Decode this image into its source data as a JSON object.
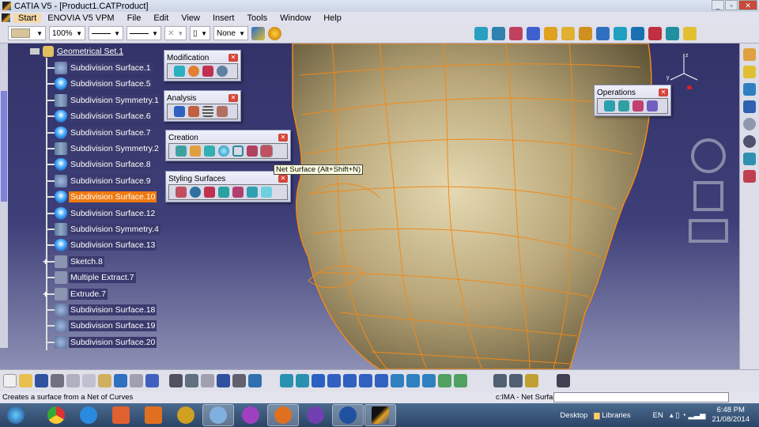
{
  "window": {
    "title": "CATIA V5 - [Product1.CATProduct]",
    "buttons": [
      "minimize",
      "restore",
      "close"
    ]
  },
  "menu": [
    "Start",
    "ENOVIA V5 VPM",
    "File",
    "Edit",
    "View",
    "Insert",
    "Tools",
    "Window",
    "Help"
  ],
  "top_toolbar": {
    "color_swatch": "#d8c49a",
    "zoom": "100%",
    "layer": "None"
  },
  "tree": {
    "root": "Geometrical Set.1",
    "items": [
      {
        "label": "Subdivision Surface.1",
        "icon": "subdivision-surface-icon"
      },
      {
        "label": "Subdivision Surface.5",
        "icon": "subdivision-surface-icon"
      },
      {
        "label": "Subdivision Symmetry.1",
        "icon": "subdivision-symmetry-icon"
      },
      {
        "label": "Subdivision Surface.6",
        "icon": "subdivision-surface-icon"
      },
      {
        "label": "Subdivision Surface.7",
        "icon": "subdivision-surface-icon"
      },
      {
        "label": "Subdivision Symmetry.2",
        "icon": "subdivision-symmetry-icon"
      },
      {
        "label": "Subdivision Surface.8",
        "icon": "subdivision-surface-icon"
      },
      {
        "label": "Subdivision Surface.9",
        "icon": "subdivision-surface-icon"
      },
      {
        "label": "Subdivision Surface.10",
        "icon": "subdivision-surface-icon",
        "selected": true
      },
      {
        "label": "Subdivision Surface.12",
        "icon": "subdivision-surface-icon"
      },
      {
        "label": "Subdivision Symmetry.4",
        "icon": "subdivision-symmetry-icon"
      },
      {
        "label": "Subdivision Surface.13",
        "icon": "subdivision-surface-icon"
      },
      {
        "label": "Sketch.8",
        "icon": "sketch-icon",
        "expandable": true
      },
      {
        "label": "Multiple Extract.7",
        "icon": "extract-icon"
      },
      {
        "label": "Extrude.7",
        "icon": "extrude-icon",
        "expandable": true
      },
      {
        "label": "Subdivision Surface.18",
        "icon": "subdivision-surface-icon"
      },
      {
        "label": "Subdivision Surface.19",
        "icon": "subdivision-surface-icon"
      },
      {
        "label": "Subdivision Surface.20",
        "icon": "subdivision-surface-icon"
      }
    ]
  },
  "panels": {
    "modification": {
      "title": "Modification",
      "count": 4
    },
    "analysis": {
      "title": "Analysis",
      "count": 4
    },
    "creation": {
      "title": "Creation",
      "count": 7
    },
    "styling": {
      "title": "Styling Surfaces",
      "count": 7
    },
    "operations": {
      "title": "Operations",
      "count": 4
    }
  },
  "tooltip": "Net Surface (Alt+Shift+N)",
  "status": {
    "message": "Creates a surface from a Net of Curves",
    "command": "c:IMA - Net Surface",
    "input": ""
  },
  "taskbar": {
    "apps": [
      "windows-start",
      "chrome",
      "internet-explorer",
      "paint-app",
      "media-player",
      "video-app",
      "paint",
      "messenger",
      "firefox",
      "viber",
      "camera-app",
      "catia"
    ],
    "desktop": "Desktop",
    "libraries": "Libraries",
    "lang": "EN",
    "time": "6:48 PM",
    "date": "21/08/2014"
  },
  "colors": {
    "selection": "#f07a10",
    "mesh": "#f08a1a",
    "skin": "#b8a678",
    "viewport": "#33336a"
  }
}
